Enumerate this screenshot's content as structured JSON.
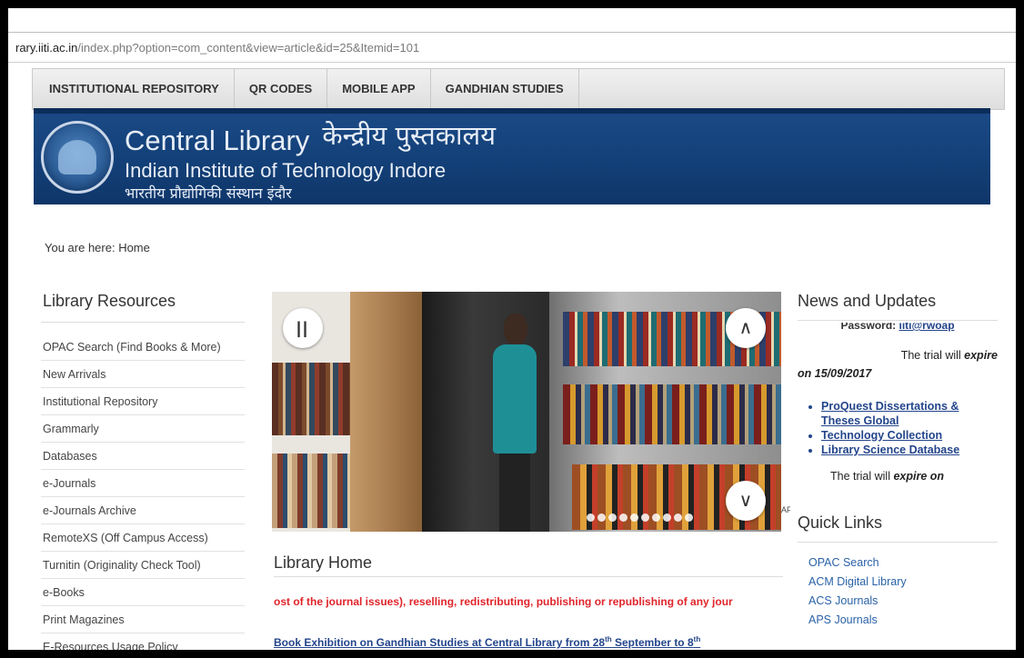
{
  "address_bar": {
    "host": "rary.iiti.ac.in",
    "path": "/index.php?option=com_content&view=article&id=25&Itemid=101"
  },
  "top_nav": [
    {
      "label": "INSTITUTIONAL REPOSITORY"
    },
    {
      "label": "QR CODES"
    },
    {
      "label": "MOBILE APP"
    },
    {
      "label": "GANDHIAN STUDIES"
    }
  ],
  "banner": {
    "title_en": "Central Library",
    "title_hi": "केन्द्रीय पुस्तकालय",
    "subtitle_en": "Indian Institute of Technology Indore",
    "subtitle_hi": "भारतीय प्रौद्योगिकी संस्थान इंदौर"
  },
  "breadcrumb": "You are here: Home",
  "sidebar": {
    "title": "Library Resources",
    "items": [
      {
        "label": "OPAC Search (Find Books & More)"
      },
      {
        "label": "New Arrivals"
      },
      {
        "label": "Institutional Repository"
      },
      {
        "label": "Grammarly"
      },
      {
        "label": "Databases"
      },
      {
        "label": "e-Journals"
      },
      {
        "label": "e-Journals Archive"
      },
      {
        "label": "RemoteXS (Off Campus Access)"
      },
      {
        "label": "Turnitin (Originality Check Tool)"
      },
      {
        "label": "e-Books"
      },
      {
        "label": "Print Magazines"
      },
      {
        "label": "E-Resources Usage Policy"
      }
    ]
  },
  "slider": {
    "pause_icon": "pause-icon",
    "up_icon": "chevron-up-icon",
    "down_icon": "chevron-down-icon",
    "pause_glyph": "||",
    "up_glyph": "∧",
    "down_glyph": "∨",
    "dot_count": 10,
    "side_tag": "AF"
  },
  "main": {
    "heading": "Library Home",
    "red_notice": "ost of the journal issues), reselling, redistributing, publishing or republishing of any jour",
    "exhibition_text": "Book Exhibition on Gandhian Studies at Central Library from 28",
    "exhibition_sup1": "th",
    "exhibition_mid": " September to 8",
    "exhibition_sup2": "th"
  },
  "news": {
    "title": "News and Updates",
    "password_label": "Password:",
    "password_value": "iiti@rwoap",
    "trial1_prefix": "The trial will ",
    "trial1_expire": "expire",
    "trial1_suffix": "on 15/09/2017",
    "links": [
      {
        "label": "ProQuest Dissertations & Theses Global"
      },
      {
        "label": "Technology Collection"
      },
      {
        "label": "Library Science Database"
      }
    ],
    "trial2_prefix": "The trial will ",
    "trial2_expire": "expire on"
  },
  "quick_links": {
    "title": "Quick Links",
    "links": [
      {
        "label": "OPAC Search"
      },
      {
        "label": "ACM Digital Library"
      },
      {
        "label": "ACS Journals"
      },
      {
        "label": "APS Journals"
      }
    ]
  },
  "colors": {
    "banner_blue": "#134078",
    "link_blue": "#23458b",
    "notice_red": "#e0242a"
  }
}
